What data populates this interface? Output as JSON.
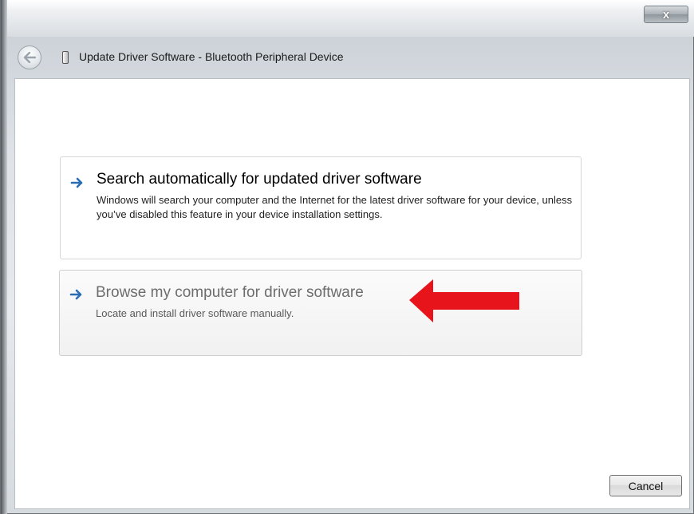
{
  "window": {
    "title": "Update Driver Software - Bluetooth Peripheral Device",
    "close_glyph": "x",
    "back_icon": "back-arrow-icon",
    "device_icon": "bluetooth-device-icon"
  },
  "options": [
    {
      "title": "Search automatically for updated driver software",
      "description": "Windows will search your computer and the Internet for the latest driver software for your device, unless you’ve disabled this feature in your device installation settings.",
      "icon": "arrow-right-icon"
    },
    {
      "title": "Browse my computer for driver software",
      "description": "Locate and install driver software manually.",
      "icon": "arrow-right-icon",
      "state": "hover"
    }
  ],
  "annotation": {
    "icon": "red-pointer-arrow-icon",
    "color": "#e8141b"
  },
  "footer": {
    "cancel_label": "Cancel"
  }
}
